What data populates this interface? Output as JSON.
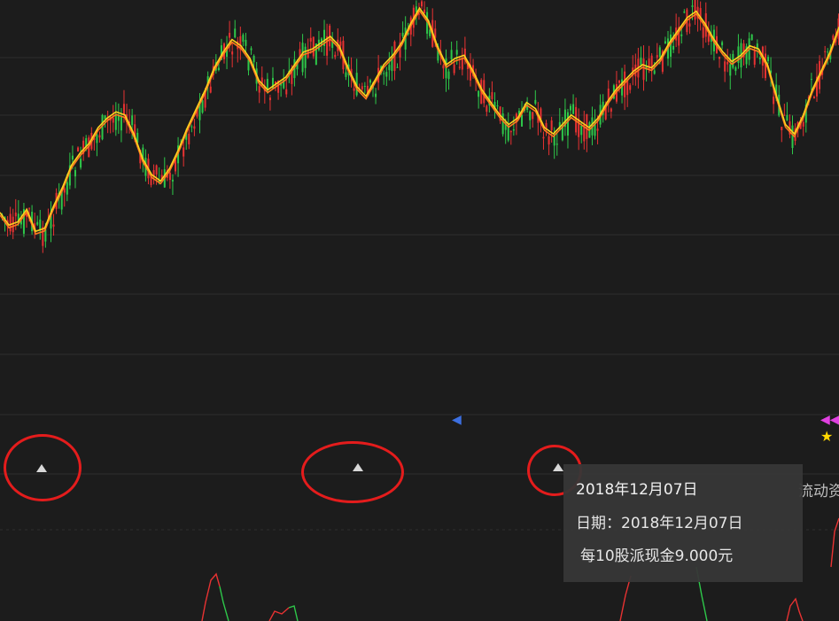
{
  "colors": {
    "background": "#1c1c1c",
    "grid": "#2e2e2e",
    "candle_up": "#e83232",
    "candle_down": "#2ec84a",
    "ma_line": "#ffd21e",
    "ma_line_2": "#ff7a1e",
    "annotation_circle": "#e41c1c",
    "event_marker": "#d8d8d8",
    "blue_flag": "#3c6fe0",
    "magenta_flag": "#e040e0",
    "star": "#ffd700"
  },
  "price_panel": {
    "ma_points": [
      0.33,
      0.29,
      0.3,
      0.34,
      0.27,
      0.28,
      0.35,
      0.41,
      0.48,
      0.52,
      0.55,
      0.6,
      0.63,
      0.65,
      0.64,
      0.58,
      0.5,
      0.45,
      0.43,
      0.47,
      0.53,
      0.6,
      0.66,
      0.72,
      0.79,
      0.84,
      0.88,
      0.86,
      0.82,
      0.75,
      0.72,
      0.74,
      0.76,
      0.8,
      0.84,
      0.85,
      0.87,
      0.89,
      0.86,
      0.79,
      0.73,
      0.7,
      0.75,
      0.8,
      0.83,
      0.87,
      0.93,
      0.98,
      0.94,
      0.86,
      0.8,
      0.82,
      0.83,
      0.78,
      0.72,
      0.68,
      0.64,
      0.61,
      0.63,
      0.68,
      0.66,
      0.6,
      0.58,
      0.61,
      0.64,
      0.62,
      0.6,
      0.63,
      0.68,
      0.72,
      0.75,
      0.78,
      0.8,
      0.79,
      0.82,
      0.87,
      0.91,
      0.95,
      0.97,
      0.93,
      0.88,
      0.84,
      0.81,
      0.83,
      0.86,
      0.85,
      0.8,
      0.7,
      0.61,
      0.58,
      0.64,
      0.72,
      0.78,
      0.84,
      0.92
    ]
  },
  "event_markers": [
    {
      "name": "dividend-marker-1",
      "circled": true
    },
    {
      "name": "dividend-marker-2",
      "circled": true
    },
    {
      "name": "dividend-marker-3",
      "circled": true
    }
  ],
  "tooltip": {
    "title": "2018年12月07日",
    "date_line": "日期：2018年12月07日",
    "dividend_line": "每10股派现金9.000元"
  },
  "partial_label": "流动资"
}
